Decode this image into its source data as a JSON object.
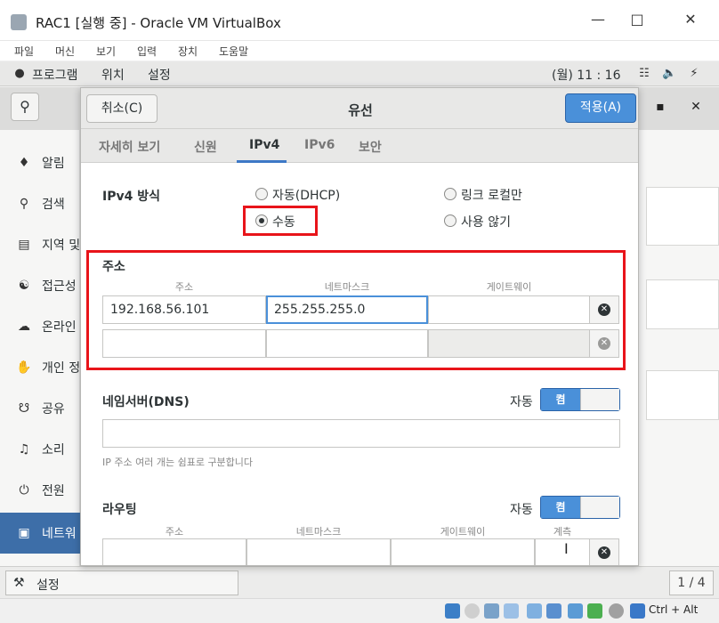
{
  "window": {
    "title": "RAC1 [실행 중] - Oracle VM VirtualBox",
    "menu": [
      "파일",
      "머신",
      "보기",
      "입력",
      "장치",
      "도움말"
    ]
  },
  "topbar": {
    "programs": "프로그램",
    "places": "위치",
    "settings": "설정",
    "clock": "(월) 11 : 16"
  },
  "sidebar": {
    "items": [
      {
        "label": "알림",
        "icon": "bell-icon"
      },
      {
        "label": "검색",
        "icon": "search-icon"
      },
      {
        "label": "지역 및",
        "icon": "region-icon"
      },
      {
        "label": "접근성",
        "icon": "accessibility-icon"
      },
      {
        "label": "온라인",
        "icon": "online-accounts-icon"
      },
      {
        "label": "개인 정",
        "icon": "privacy-hand-icon"
      },
      {
        "label": "공유",
        "icon": "share-icon"
      },
      {
        "label": "소리",
        "icon": "speaker-icon"
      },
      {
        "label": "전원",
        "icon": "power-icon"
      },
      {
        "label": "네트워",
        "icon": "network-icon"
      }
    ]
  },
  "bottombar": {
    "settings_label": "설정",
    "pager": "1 / 4"
  },
  "statusbar": {
    "hostkey": "Ctrl + Alt"
  },
  "dialog": {
    "title": "유선",
    "cancel_label": "취소(C)",
    "apply_label": "적용(A)",
    "tabs": [
      "자세히 보기",
      "신원",
      "IPv4",
      "IPv6",
      "보안"
    ],
    "active_tab": "IPv4",
    "ipv4": {
      "method_label": "IPv4 방식",
      "methods": [
        {
          "label": "자동(DHCP)",
          "checked": false
        },
        {
          "label": "링크 로컬만",
          "checked": false
        },
        {
          "label": "수동",
          "checked": true
        },
        {
          "label": "사용 않기",
          "checked": false
        }
      ],
      "address_section_label": "주소",
      "address_columns": [
        "주소",
        "네트마스크",
        "게이트웨이"
      ],
      "address_rows": [
        {
          "address": "192.168.56.101",
          "netmask": "255.255.255.0",
          "gateway": ""
        },
        {
          "address": "",
          "netmask": "",
          "gateway": ""
        }
      ],
      "dns_label": "네임서버(DNS)",
      "dns_auto_label": "자동",
      "dns_switch_label": "켬",
      "dns_value": "",
      "dns_hint": "IP 주소 여러 개는 쉼표로 구분합니다",
      "routing_label": "라우팅",
      "routing_auto_label": "자동",
      "routing_switch_label": "켬",
      "routing_columns": [
        "주소",
        "네트마스크",
        "게이트웨이",
        "계측"
      ]
    }
  }
}
